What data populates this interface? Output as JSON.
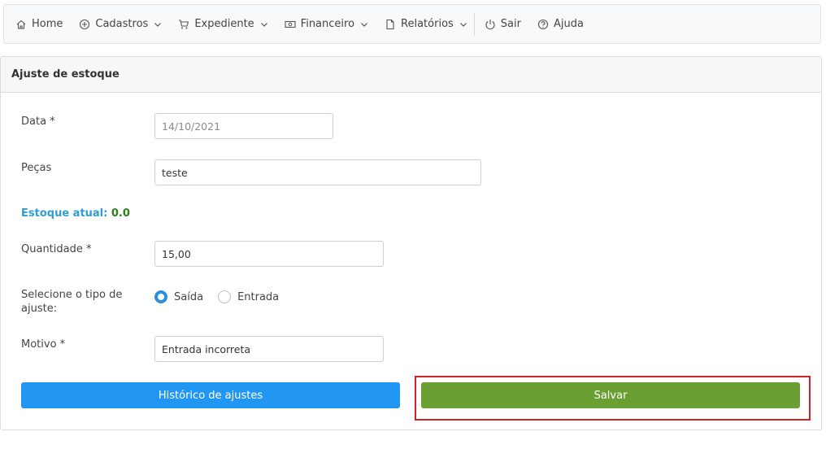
{
  "nav": {
    "home": "Home",
    "cadastros": "Cadastros",
    "expediente": "Expediente",
    "financeiro": "Financeiro",
    "relatorios": "Relatórios",
    "sair": "Sair",
    "ajuda": "Ajuda"
  },
  "card": {
    "title": "Ajuste de estoque"
  },
  "form": {
    "data_label": "Data *",
    "data_value": "14/10/2021",
    "pecas_label": "Peças",
    "pecas_value": "teste",
    "estoque_label": "Estoque atual:",
    "estoque_value": "0.0",
    "quantidade_label": "Quantidade *",
    "quantidade_value": "15,00",
    "tipo_label": "Selecione o tipo de ajuste:",
    "tipo_options": [
      "Saída",
      "Entrada"
    ],
    "tipo_selected": "Saída",
    "motivo_label": "Motivo *",
    "motivo_value": "Entrada incorreta"
  },
  "buttons": {
    "historico": "Histórico de ajustes",
    "salvar": "Salvar"
  },
  "colors": {
    "primary": "#2196f3",
    "success": "#6a9f34",
    "highlight": "#d0202a"
  }
}
